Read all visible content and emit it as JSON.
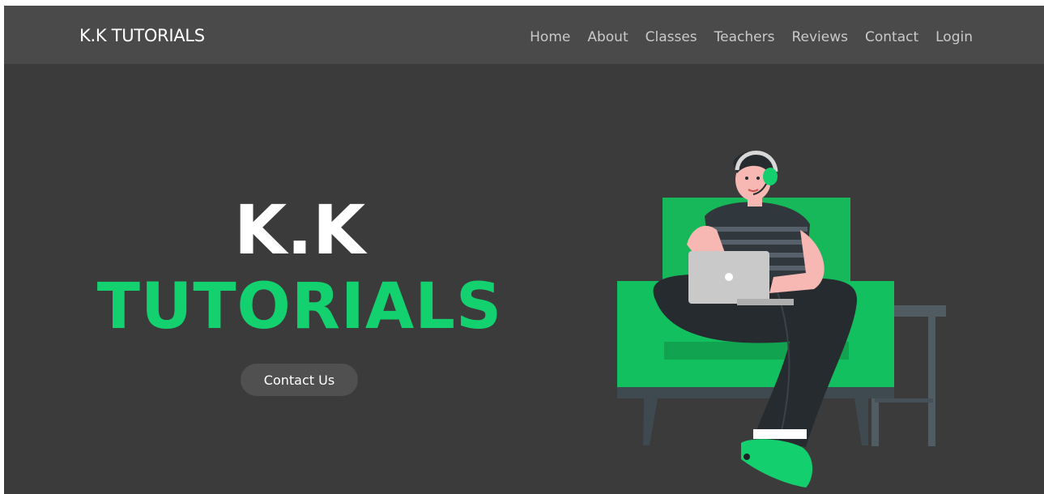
{
  "header": {
    "brand": "K.K TUTORIALS",
    "nav": [
      {
        "label": "Home"
      },
      {
        "label": "About"
      },
      {
        "label": "Classes"
      },
      {
        "label": "Teachers"
      },
      {
        "label": "Reviews"
      },
      {
        "label": "Contact"
      },
      {
        "label": "Login"
      }
    ]
  },
  "hero": {
    "title_line1": "K.K",
    "title_line2": "TUTORIALS",
    "cta_label": "Contact Us",
    "illustration_icon": "student-with-laptop-on-sofa-illustration"
  },
  "colors": {
    "background": "#3b3b3b",
    "navbar": "#4a4a4a",
    "accent": "#13d16f",
    "button": "#505050"
  }
}
